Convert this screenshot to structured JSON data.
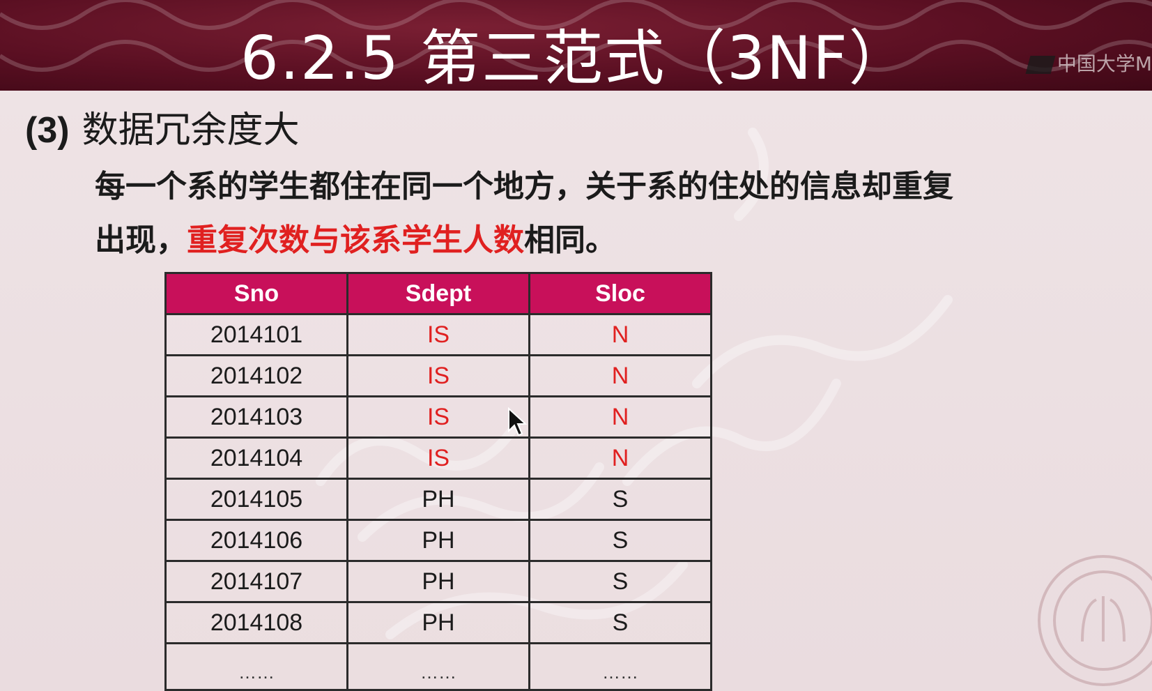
{
  "slide": {
    "title": "6.2.5 第三范式（3NF）",
    "logo_text": "中国大学M"
  },
  "section": {
    "number": "(3)",
    "heading": "数据冗余度大"
  },
  "paragraph": {
    "line1": "每一个系的学生都住在同一个地方，关于系的住处的信息却重复",
    "line2_start": "出现，",
    "line2_highlight": "重复次数与该系学生人数",
    "line2_end": "相同。"
  },
  "table": {
    "headers": [
      "Sno",
      "Sdept",
      "Sloc"
    ],
    "rows": [
      [
        "2014101",
        "IS",
        "N"
      ],
      [
        "2014102",
        "IS",
        "N"
      ],
      [
        "2014103",
        "IS",
        "N"
      ],
      [
        "2014104",
        "IS",
        "N"
      ],
      [
        "2014105",
        "PH",
        "S"
      ],
      [
        "2014106",
        "PH",
        "S"
      ],
      [
        "2014107",
        "PH",
        "S"
      ],
      [
        "2014108",
        "PH",
        "S"
      ],
      [
        "……",
        "……",
        "……"
      ]
    ],
    "highlight_rows": [
      0,
      1,
      2,
      3
    ]
  },
  "colors": {
    "banner": "#5a0f22",
    "header_fill": "#c8105a",
    "highlight": "#e02020"
  }
}
